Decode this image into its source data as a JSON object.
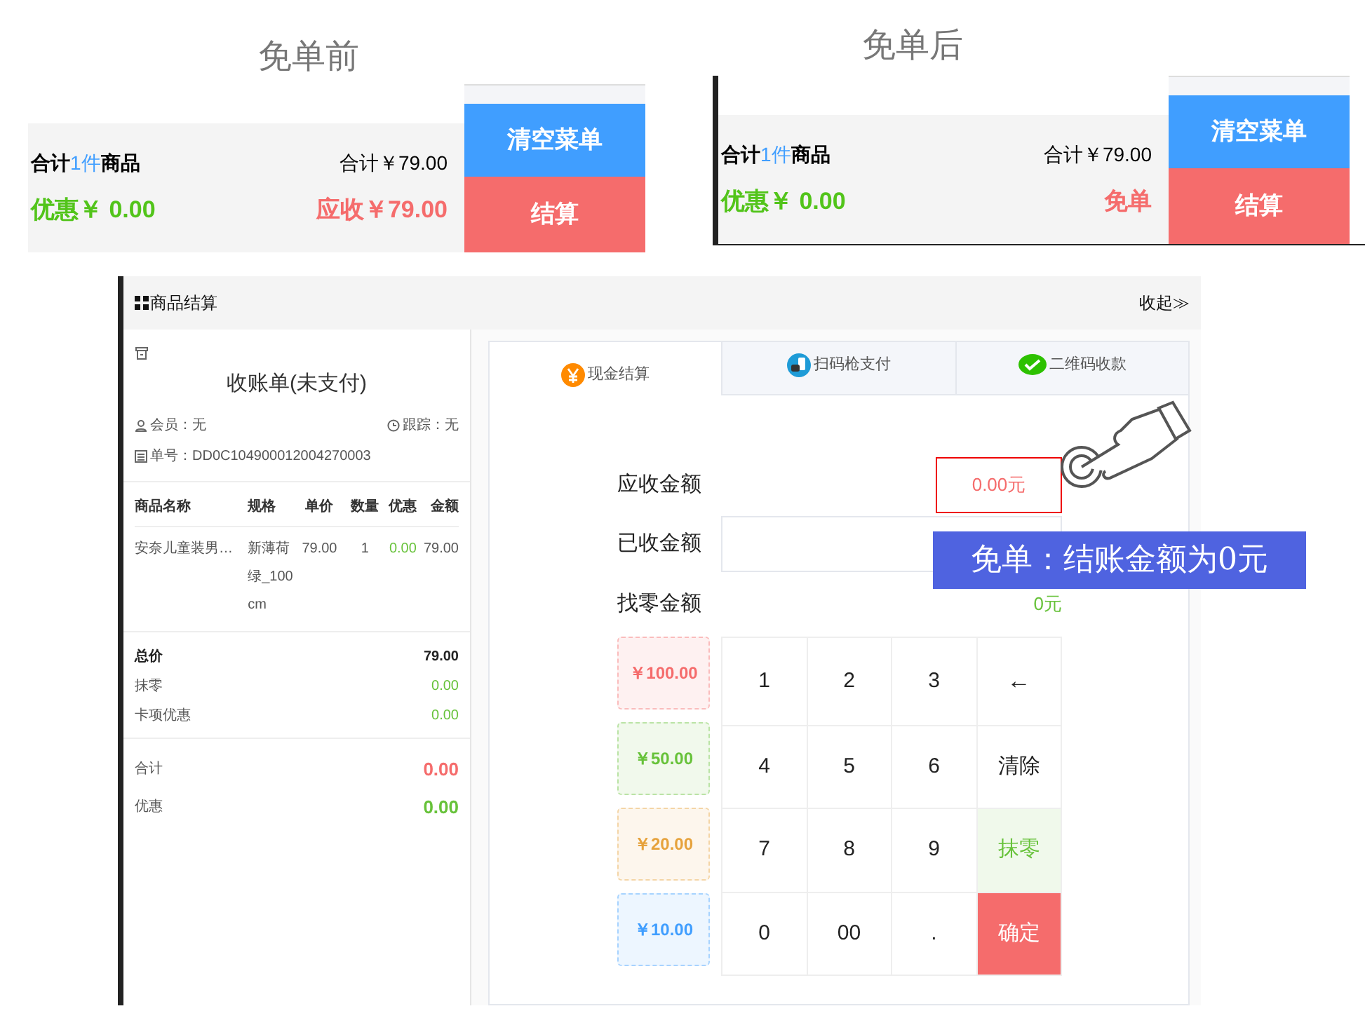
{
  "panels": [
    {
      "title": "免单前",
      "count": {
        "before": "合计",
        "number": "1件",
        "after": "商品"
      },
      "total": "合计￥79.00",
      "discount": "优惠￥ 0.00",
      "receivable": "应收￥79.00",
      "buttons": [
        "清空菜单",
        "结算"
      ],
      "framed": false
    },
    {
      "title": "免单后",
      "count": {
        "before": "合计",
        "number": "1件",
        "after": "商品"
      },
      "total": "合计￥79.00",
      "discount": "优惠￥ 0.00",
      "receivable": "免单",
      "buttons": [
        "清空菜单",
        "结算"
      ],
      "framed": true
    }
  ],
  "checkout": {
    "title": "商品结算",
    "collapse": "收起≫",
    "receipt": {
      "title": "收账单(未支付)",
      "member": "会员：无",
      "tracker": "跟踪：无",
      "order_no": "单号：DD0C104900012004270003",
      "columns": [
        "商品名称",
        "规格",
        "单价",
        "数量",
        "优惠",
        "金额"
      ],
      "rows": [
        [
          "安奈儿童装男…",
          "新薄荷绿_100cm",
          "79.00",
          "1",
          "0.00",
          "79.00"
        ]
      ],
      "summary": [
        {
          "label": "总价",
          "value": "79.00",
          "kind": "bold"
        },
        {
          "label": "抹零",
          "value": "0.00",
          "kind": "discount"
        },
        {
          "label": "卡项优惠",
          "value": "0.00",
          "kind": "discount"
        }
      ],
      "totals": [
        {
          "label": "合计",
          "value": "0.00",
          "kind": "due"
        },
        {
          "label": "优惠",
          "value": "0.00",
          "kind": "discount"
        }
      ]
    },
    "tabs": [
      {
        "label": "现金结算",
        "selected": true,
        "kind": "cash"
      },
      {
        "label": "扫码枪支付",
        "selected": false,
        "kind": "scanner"
      },
      {
        "label": "二维码收款",
        "selected": false,
        "kind": "qrcode"
      }
    ],
    "form": {
      "due_label": "应收金额",
      "due_value": "0.00元",
      "received_label": "已收金额",
      "change_label": "找零金额",
      "change_value": "0元"
    },
    "quick_amounts": [
      {
        "label": "￥100.00",
        "color": "#f56c6c"
      },
      {
        "label": "￥50.00",
        "color": "#67c23a"
      },
      {
        "label": "￥20.00",
        "color": "#e6a23c"
      },
      {
        "label": "￥10.00",
        "color": "#409eff"
      }
    ],
    "keys": [
      {
        "label": "1",
        "kind": "digit"
      },
      {
        "label": "2",
        "kind": "digit"
      },
      {
        "label": "3",
        "kind": "digit"
      },
      {
        "label": "←",
        "kind": "back"
      },
      {
        "label": "4",
        "kind": "digit"
      },
      {
        "label": "5",
        "kind": "digit"
      },
      {
        "label": "6",
        "kind": "digit"
      },
      {
        "label": "清除",
        "kind": "clear"
      },
      {
        "label": "7",
        "kind": "digit"
      },
      {
        "label": "8",
        "kind": "digit"
      },
      {
        "label": "9",
        "kind": "digit"
      },
      {
        "label": "抹零",
        "kind": "round"
      },
      {
        "label": "0",
        "kind": "digit"
      },
      {
        "label": "00",
        "kind": "digit"
      },
      {
        "label": ".",
        "kind": "digit"
      },
      {
        "label": "确定",
        "kind": "confirm"
      }
    ],
    "callout": "免单：结账金额为0元"
  }
}
